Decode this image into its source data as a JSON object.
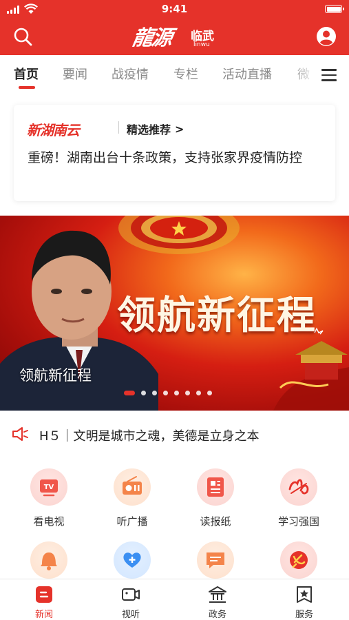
{
  "status_bar": {
    "time": "9:41"
  },
  "header": {
    "logo_text": "龍源",
    "logo_city": "临武",
    "logo_pinyin": "linwu"
  },
  "tabs": [
    {
      "label": "首页",
      "active": true
    },
    {
      "label": "要闻"
    },
    {
      "label": "战疫情"
    },
    {
      "label": "专栏"
    },
    {
      "label": "活动直播"
    },
    {
      "label": "微"
    }
  ],
  "recommend": {
    "brand": "新湖南云",
    "title": "精选推荐",
    "chevron": ">",
    "headline": "重磅！湖南出台十条政策，支持张家界疫情防控"
  },
  "banner": {
    "slogan": "领航新征程",
    "caption": "领航新征程",
    "slide_count": 8,
    "active_slide": 1
  },
  "notice": {
    "text": "H５｜文明是城市之魂，美德是立身之本"
  },
  "shortcuts": [
    {
      "label": "看电视",
      "icon": "tv-icon"
    },
    {
      "label": "听广播",
      "icon": "radio-icon"
    },
    {
      "label": "读报纸",
      "icon": "newspaper-icon"
    },
    {
      "label": "学习强国",
      "icon": "xuexi-icon"
    },
    {
      "label": "",
      "icon": "bell-icon"
    },
    {
      "label": "",
      "icon": "heart-plus-icon"
    },
    {
      "label": "",
      "icon": "message-icon"
    },
    {
      "label": "",
      "icon": "party-emblem-icon"
    }
  ],
  "bottom_nav": [
    {
      "label": "新闻",
      "icon": "news-icon",
      "active": true
    },
    {
      "label": "视听",
      "icon": "video-icon"
    },
    {
      "label": "政务",
      "icon": "government-icon"
    },
    {
      "label": "服务",
      "icon": "service-icon"
    }
  ],
  "colors": {
    "brand_red": "#e5322a",
    "text_dark": "#222222",
    "text_gray": "#8a8a8a"
  }
}
